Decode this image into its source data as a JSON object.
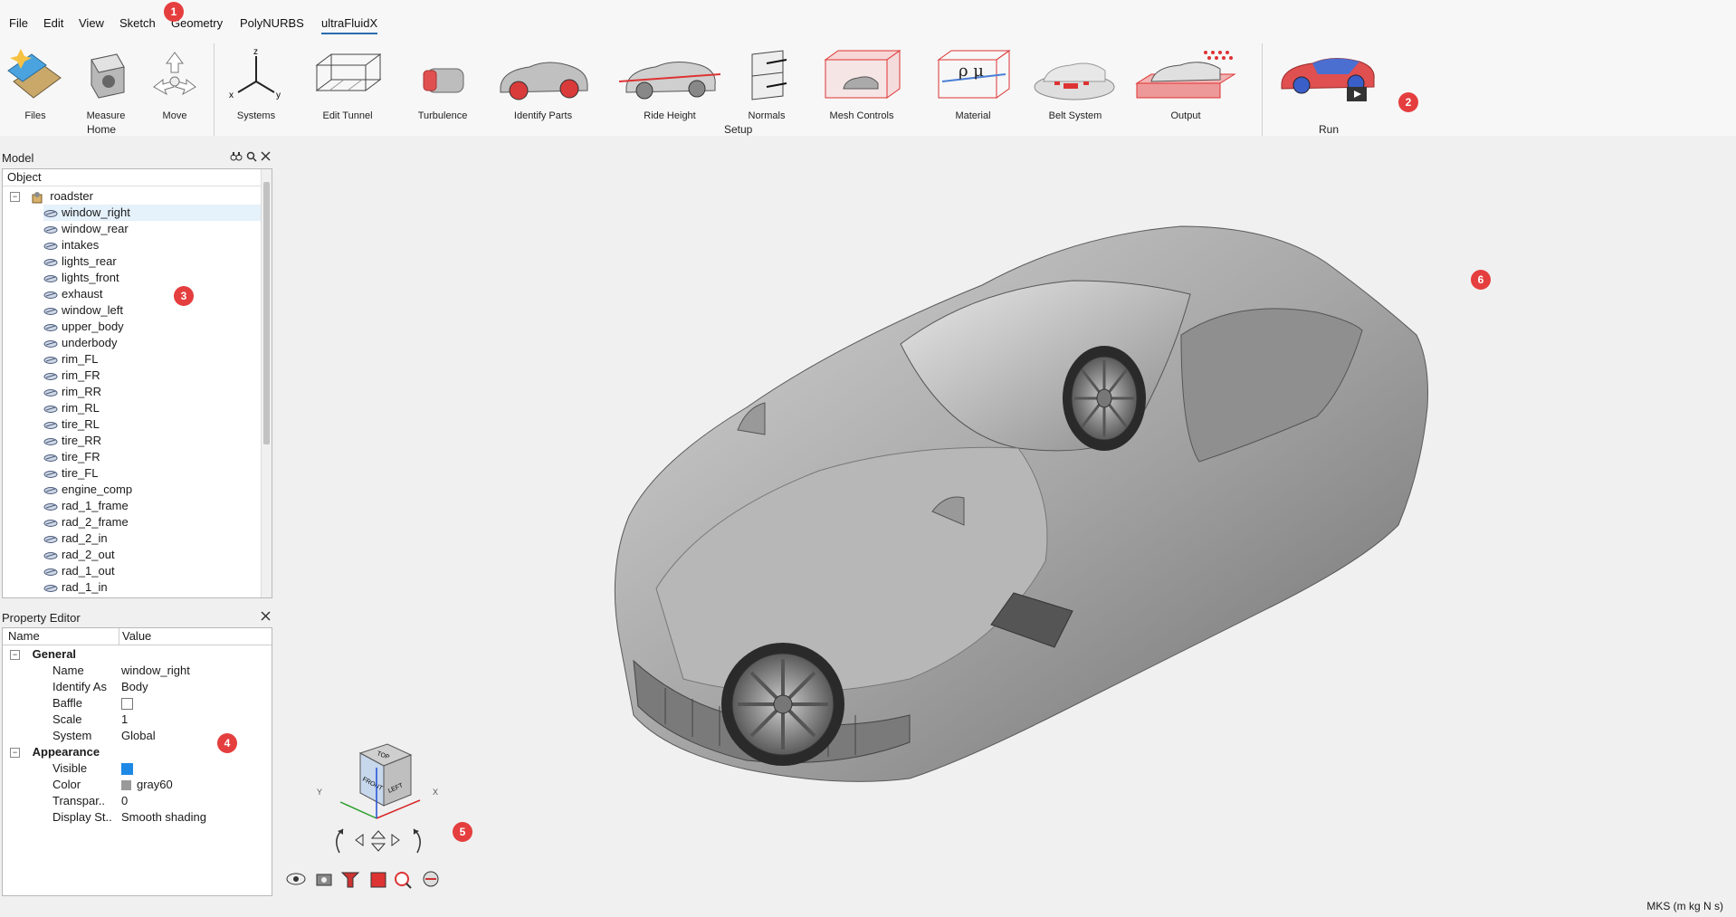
{
  "menu": {
    "items": [
      "File",
      "Edit",
      "View",
      "Sketch",
      "Geometry",
      "PolyNURBS",
      "ultraFluidX"
    ],
    "active_index": 6
  },
  "ribbon": {
    "buttons": {
      "files": "Files",
      "measure": "Measure",
      "move": "Move",
      "systems": "Systems",
      "edit_tunnel": "Edit Tunnel",
      "turbulence": "Turbulence",
      "identify_parts": "Identify Parts",
      "ride_height": "Ride Height",
      "normals": "Normals",
      "mesh_controls": "Mesh Controls",
      "material": "Material",
      "belt_system": "Belt System",
      "output": "Output",
      "run": "Run"
    },
    "groups": {
      "home": "Home",
      "setup": "Setup",
      "run": "Run"
    },
    "axis_letters": {
      "z": "z",
      "x": "x",
      "y": "y"
    },
    "material_symbols": "ρ μ"
  },
  "model_panel": {
    "title": "Model",
    "column": "Object",
    "root": "roadster",
    "selected": "window_right",
    "items": [
      "window_right",
      "window_rear",
      "intakes",
      "lights_rear",
      "lights_front",
      "exhaust",
      "window_left",
      "upper_body",
      "underbody",
      "rim_FL",
      "rim_FR",
      "rim_RR",
      "rim_RL",
      "tire_RL",
      "tire_RR",
      "tire_FR",
      "tire_FL",
      "engine_comp",
      "rad_1_frame",
      "rad_2_frame",
      "rad_2_in",
      "rad_2_out",
      "rad_1_out",
      "rad_1_in"
    ]
  },
  "property_editor": {
    "title": "Property Editor",
    "columns": {
      "name": "Name",
      "value": "Value"
    },
    "groups": {
      "general": "General",
      "appearance": "Appearance"
    },
    "general_rows": {
      "name_label": "Name",
      "name_value": "window_right",
      "identify_label": "Identify As",
      "identify_value": "Body",
      "baffle_label": "Baffle",
      "scale_label": "Scale",
      "scale_value": "1",
      "system_label": "System",
      "system_value": "Global"
    },
    "appearance_rows": {
      "visible_label": "Visible",
      "color_label": "Color",
      "color_value": "gray60",
      "transparency_label": "Transpar..",
      "transparency_value": "0",
      "display_label": "Display St..",
      "display_value": "Smooth shading"
    },
    "baffle_checked": false,
    "visible_checked": true
  },
  "view_cube": {
    "faces": {
      "top": "TOP",
      "front": "FRONT",
      "left": "LEFT"
    },
    "axes": {
      "y": "Y",
      "x": "X"
    }
  },
  "badges": [
    "1",
    "2",
    "3",
    "4",
    "5",
    "6"
  ],
  "status": {
    "units": "MKS (m kg N s)"
  },
  "colors": {
    "accent": "#2b6cb0",
    "badge": "#e53e3e",
    "car": "#9a9a9a"
  },
  "icons": [
    "files-icon",
    "measure-icon",
    "move-icon",
    "systems-icon",
    "edit-tunnel-icon",
    "turbulence-icon",
    "identify-parts-icon",
    "ride-height-icon",
    "normals-icon",
    "mesh-controls-icon",
    "material-icon",
    "belt-system-icon",
    "output-icon",
    "run-icon",
    "search-icon",
    "binoculars-icon",
    "close-icon"
  ]
}
